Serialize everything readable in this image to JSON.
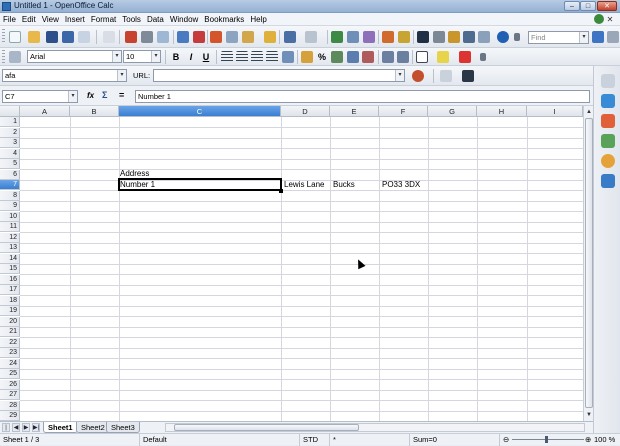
{
  "window": {
    "title": "Untitled 1 - OpenOffice Calc"
  },
  "menu": [
    "File",
    "Edit",
    "View",
    "Insert",
    "Format",
    "Tools",
    "Data",
    "Window",
    "Bookmarks",
    "Help"
  ],
  "toolbar": {
    "font_name": "Arial",
    "font_size": "10",
    "bold": "B",
    "italic": "I",
    "underline": "U",
    "search_placeholder": "Find",
    "percent_label": "%"
  },
  "url_bar": {
    "name_field": "afa",
    "label": "URL:"
  },
  "formula_bar": {
    "cell_ref": "C7",
    "func_label": "fx",
    "sum_label": "Σ",
    "eq_label": "=",
    "content": "Number 1"
  },
  "sheet": {
    "columns": [
      "A",
      "B",
      "C",
      "D",
      "E",
      "F",
      "G",
      "H",
      "I"
    ],
    "selected_column": "C",
    "rows": [
      "1",
      "2",
      "3",
      "4",
      "5",
      "6",
      "7",
      "8",
      "9",
      "10",
      "11",
      "12",
      "13",
      "14",
      "15",
      "16",
      "17",
      "18",
      "19",
      "20",
      "21",
      "22",
      "23",
      "24",
      "25",
      "26",
      "27",
      "28",
      "29"
    ],
    "selected_row": "7",
    "cells": {
      "C6": "Address",
      "C7": "Number 1",
      "D7": "Lewis Lane",
      "E7": "Bucks",
      "F7": "PO33 3DX"
    }
  },
  "tabs": [
    "Sheet1",
    "Sheet2",
    "Sheet3"
  ],
  "active_tab": "Sheet1",
  "status": {
    "sheet": "Sheet 1 / 3",
    "page_style": "Default",
    "mode": "STD",
    "modified": "*",
    "sum": "Sum=0",
    "zoom": "100 %"
  }
}
